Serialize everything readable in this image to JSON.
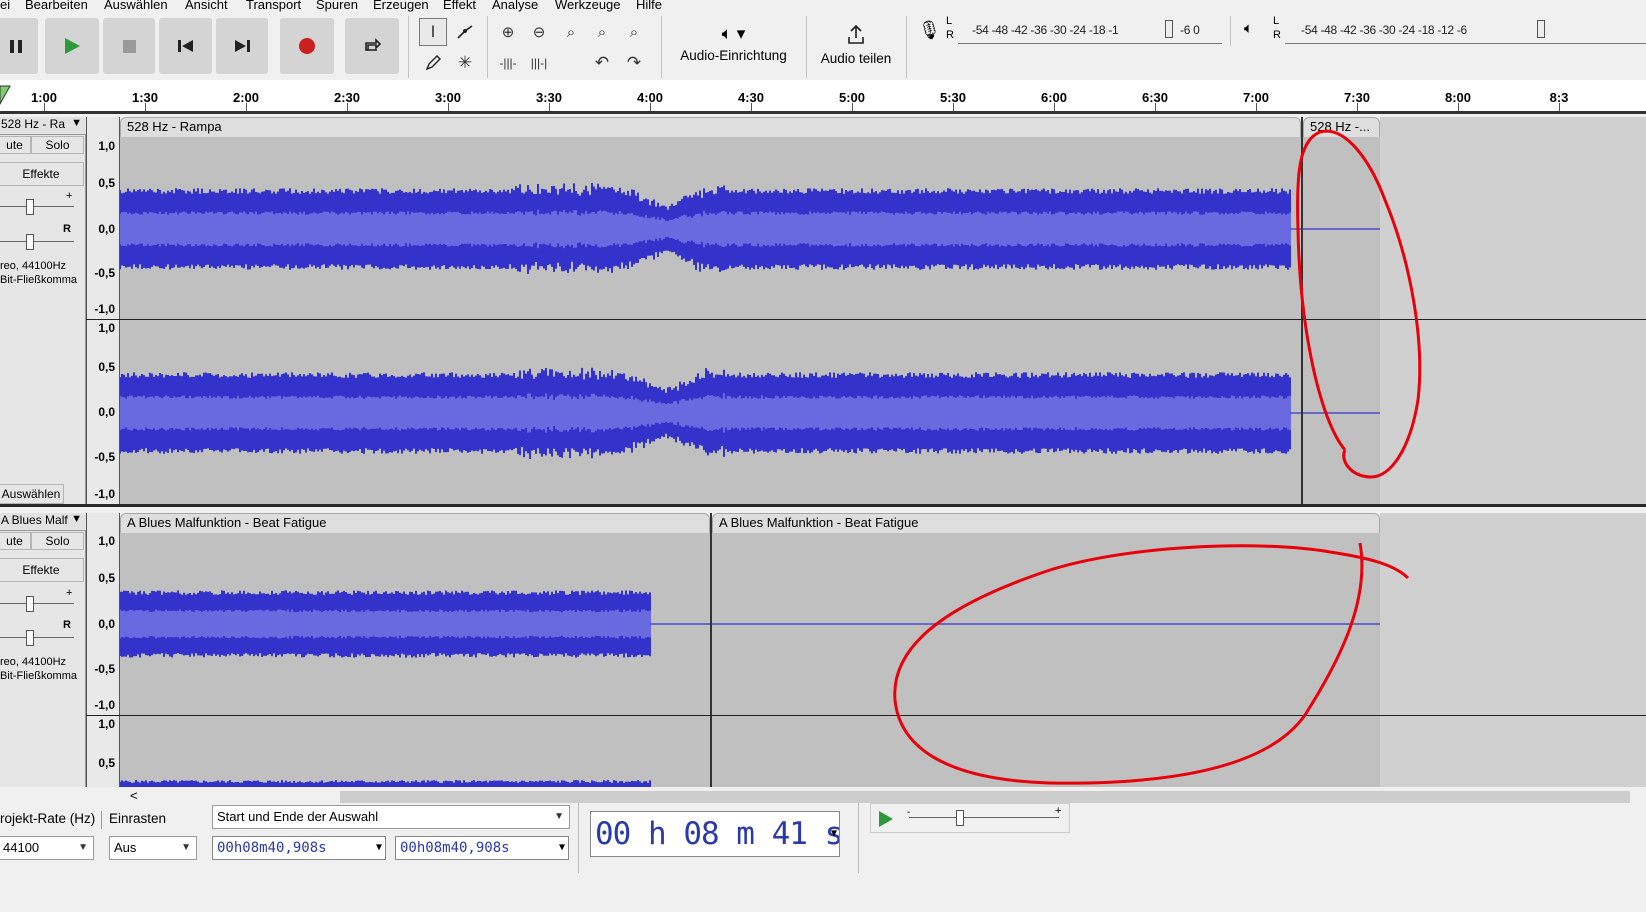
{
  "menu": [
    "ei",
    "Bearbeiten",
    "Auswählen",
    "Ansicht",
    "Transport",
    "Spuren",
    "Erzeugen",
    "Effekt",
    "Analyse",
    "Werkzeuge",
    "Hilfe"
  ],
  "toolbar": {
    "audio_setup_label": "Audio-Einrichtung",
    "share_audio_label": "Audio teilen",
    "record_meter_scale": "-54  -48  -42  -36  -30  -24  -18  -1",
    "record_meter_tail": "-6   0",
    "play_meter_scale": "-54  -48  -42  -36  -30  -24  -18  -12   -6",
    "meter_l": "L",
    "meter_r": "R"
  },
  "ruler": {
    "ticks": [
      "1:00",
      "1:30",
      "2:00",
      "2:30",
      "3:00",
      "3:30",
      "4:00",
      "4:30",
      "5:00",
      "5:30",
      "6:00",
      "6:30",
      "7:00",
      "7:30",
      "8:00",
      "8:3"
    ]
  },
  "tracks": [
    {
      "name": "528 Hz - Ra",
      "mute": "ute",
      "solo": "Solo",
      "effects": "Effekte",
      "pan_r": "R",
      "info1": "reo, 44100Hz",
      "info2": "Bit-Fließkomma",
      "select": "Auswählen",
      "clip1": "528 Hz - Rampa",
      "clip2": "528 Hz -...",
      "scale": [
        "1,0",
        "0,5",
        "0,0",
        "-0,5",
        "-1,0",
        "1,0",
        "0,5",
        "0,0",
        "-0,5",
        "-1,0"
      ]
    },
    {
      "name": "A Blues Malf",
      "mute": "ute",
      "solo": "Solo",
      "effects": "Effekte",
      "pan_r": "R",
      "info1": "reo, 44100Hz",
      "info2": "Bit-Fließkomma",
      "clip1": "A Blues Malfunktion - Beat Fatigue",
      "clip2": "A Blues Malfunktion - Beat Fatigue",
      "scale": [
        "1,0",
        "0,5",
        "0,0",
        "-0,5",
        "-1,0",
        "1,0",
        "0,5"
      ]
    }
  ],
  "bottom": {
    "rate_label": "rojekt-Rate (Hz)",
    "snap_label": "Einrasten",
    "rate_value": "44100",
    "snap_value": "Aus",
    "selection_mode": "Start und Ende der Auswahl",
    "sel_start": "00h08m40,908s",
    "sel_end": "00h08m40,908s",
    "big_time": "00 h 08 m 41 s",
    "scroll_left": "<"
  },
  "colors": {
    "wave_dark": "#3333cc",
    "wave_light": "#6a6ae0",
    "clip_bg": "#c0c0c0",
    "annotation": "#e8000a"
  }
}
